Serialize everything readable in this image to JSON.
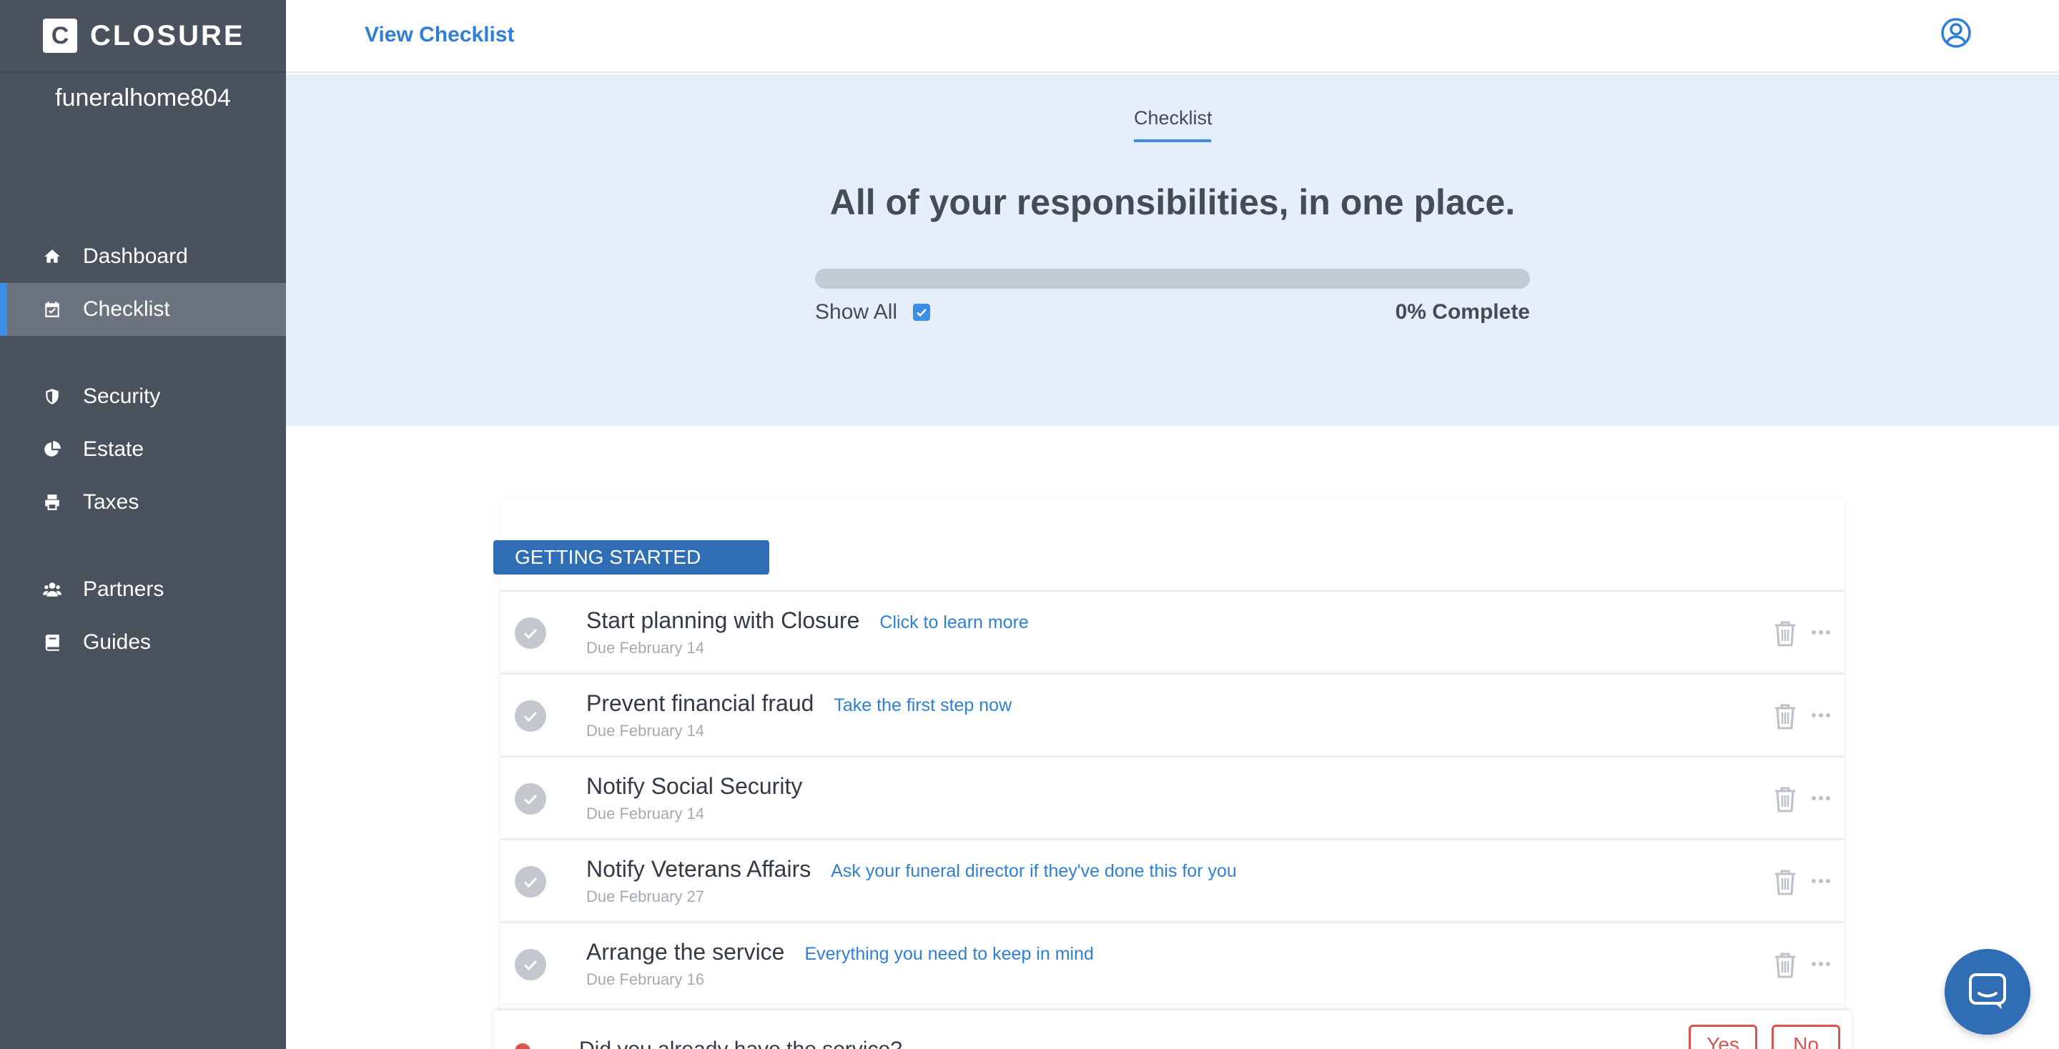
{
  "brand": {
    "letter": "C",
    "name": "CLOSURE"
  },
  "account": {
    "name": "funeralhome804"
  },
  "sidebar": {
    "items": [
      {
        "label": "Dashboard",
        "icon": "home-icon",
        "active": false
      },
      {
        "label": "Checklist",
        "icon": "calendar-check-icon",
        "active": true
      },
      {
        "label": "Security",
        "icon": "shield-icon",
        "active": false
      },
      {
        "label": "Estate",
        "icon": "pie-chart-icon",
        "active": false
      },
      {
        "label": "Taxes",
        "icon": "printer-icon",
        "active": false
      },
      {
        "label": "Partners",
        "icon": "users-icon",
        "active": false
      },
      {
        "label": "Guides",
        "icon": "book-icon",
        "active": false
      }
    ]
  },
  "topbar": {
    "title": "View Checklist",
    "user_icon": "user-circle-icon"
  },
  "hero": {
    "tab": "Checklist",
    "title": "All of your responsibilities, in one place.",
    "show_all_label": "Show All",
    "show_all_checked": true,
    "progress_percent": 0,
    "complete_label": "0% Complete"
  },
  "section": {
    "title": "GETTING STARTED"
  },
  "tasks": [
    {
      "title": "Start planning with Closure",
      "link": "Click to learn more",
      "due": "Due February 14"
    },
    {
      "title": "Prevent financial fraud",
      "link": "Take the first step now",
      "due": "Due February 14"
    },
    {
      "title": "Notify Social Security",
      "link": "",
      "due": "Due February 14"
    },
    {
      "title": "Notify Veterans Affairs",
      "link": "Ask your funeral director if they've done this for you",
      "due": "Due February 27"
    },
    {
      "title": "Arrange the service",
      "link": "Everything you need to keep in mind",
      "due": "Due February 16"
    }
  ],
  "question": {
    "text": "Did you already have the service?",
    "yes": "Yes",
    "no": "No"
  },
  "colors": {
    "sidebar": "#4a525d",
    "accent": "#3a8ee6",
    "link": "#2f7fd6",
    "hero_bg": "#e5eef9",
    "badge": "#2f6eb5",
    "danger": "#d9534f"
  }
}
